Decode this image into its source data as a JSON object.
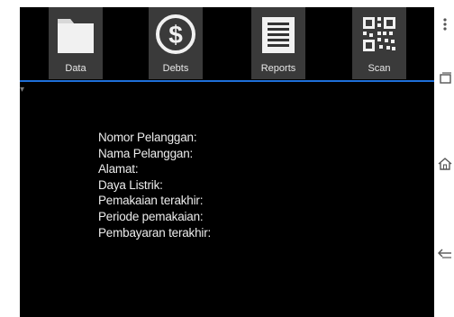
{
  "toolbar": {
    "tabs": [
      {
        "label": "Data",
        "icon": "folder-icon"
      },
      {
        "label": "Debts",
        "icon": "dollar-coin-icon"
      },
      {
        "label": "Reports",
        "icon": "report-document-icon"
      },
      {
        "label": "Scan",
        "icon": "qr-code-icon"
      }
    ],
    "accent_color": "#1e6fd9"
  },
  "customer_info": {
    "nomor_pelanggan": "Nomor Pelanggan:",
    "nama_pelanggan": "Nama Pelanggan:",
    "alamat": "Alamat:",
    "daya_listrik": "Daya Listrik:",
    "pemakaian_terakhir": "Pemakaian terakhir:",
    "periode_pemakaian": "Periode pemakaian:",
    "pembayaran_terakhir": "Pembayaran terakhir:"
  },
  "system_nav": {
    "icons": [
      "overflow-menu-icon",
      "recent-apps-icon",
      "home-icon",
      "back-icon"
    ]
  }
}
